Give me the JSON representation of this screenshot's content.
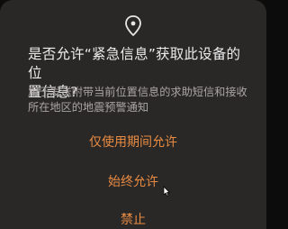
{
  "dialog": {
    "icon": "location-pin-icon",
    "title": "是否允许“紧急信息”获取此设备的位\n置信息?",
    "description": "用于发送附带当前位置信息的求助短信和接收\n所在地区的地震预警通知",
    "actions": [
      {
        "label": "仅使用期间允许"
      },
      {
        "label": "始终允许"
      },
      {
        "label": "禁止"
      }
    ]
  },
  "colors": {
    "dialog_background": "#2a2827",
    "title_text": "#ececec",
    "description_text": "#a9a6a3",
    "action_text": "#e88b42"
  }
}
